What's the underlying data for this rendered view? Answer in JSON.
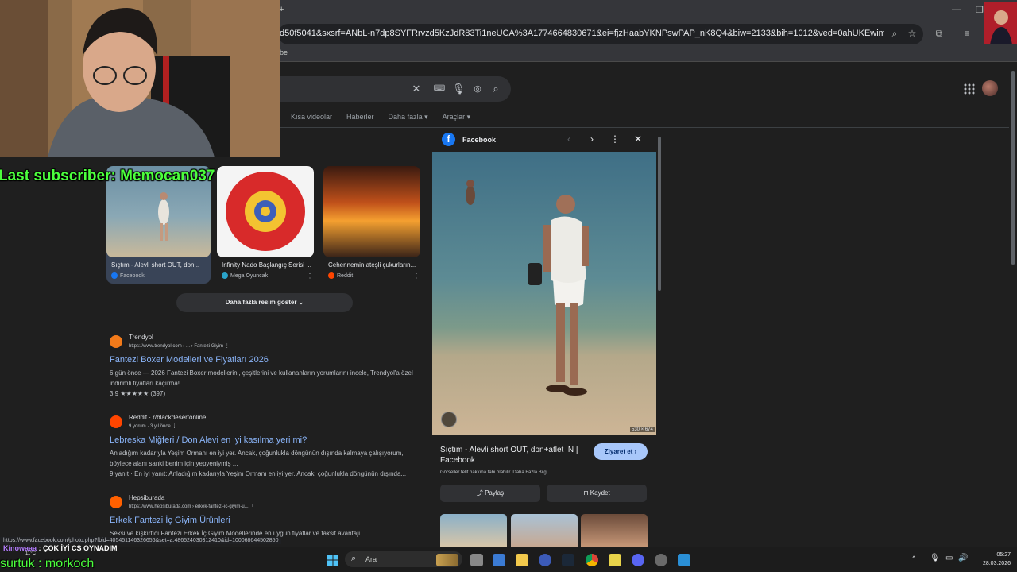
{
  "browser": {
    "url": "d50f5041&sxsrf=ANbL-n7dp8SYFRrvzd5KzJdR83Ti1neUCA%3A1774664830671&ei=fjzHaabYKNPswPAP_nK8Q4&biw=2133&bih=1012&ved=0ahUKEwimj8_WxcGTAxVTNhAIHf-8Mu4...",
    "bookmark": "be",
    "tab_plus": "+"
  },
  "search": {
    "tabs": [
      "Kısa videolar",
      "Haberler",
      "Daha fazla ▾",
      "Araçlar ▾"
    ]
  },
  "thumbs": [
    {
      "title": "Sıçtım - Alevli short OUT, don...",
      "source": "Facebook",
      "source_color": "#1877f2"
    },
    {
      "title": "Infinity Nado Başlangıç Serisi ...",
      "source": "Mega Oyuncak",
      "source_color": "#2aa3c9"
    },
    {
      "title": "Cehennemin ateşli çukurların...",
      "source": "Reddit",
      "source_color": "#ff4500"
    }
  ],
  "more_images_label": "Daha fazla resim göster ⌄",
  "results": [
    {
      "site": "Trendyol",
      "url": "https://www.trendyol.com › ... › Fantezi Giyim   ⋮",
      "title": "Fantezi Boxer Modelleri ve Fiyatları 2026",
      "snippet": "6 gün önce — 2026 Fantezi Boxer modellerini, çeşitlerini ve kullananların yorumlarını incele, Trendyol'a özel indirimli fiyatları kaçırma!",
      "meta": "3,9 ★★★★★ (397)",
      "fav_color": "#f27a1a"
    },
    {
      "site": "Reddit · r/blackdesertonline",
      "url": "9 yorum · 3 yıl önce   ⋮",
      "title": "Lebreska Miğferi / Don Alevi en iyi kasılma yeri mi?",
      "snippet": "Anladığım kadarıyla Yeşim Ormanı en iyi yer. Ancak, çoğunlukla döngünün dışında kalmaya çalışıyorum, böylece alanı sanki benim için yepyeniymiş ...",
      "meta": "9 yanıt · En iyi yanıt: Anladığım kadarıyla Yeşim Ormanı en iyi yer. Ancak, çoğunlukla döngünün dışında...",
      "fav_color": "#ff4500"
    },
    {
      "site": "Hepsiburada",
      "url": "https://www.hepsiburada.com › erkek-fantezi-ic-giyim-u...   ⋮",
      "title": "Erkek Fantezi İç Giyim Ürünleri",
      "snippet": "Seksi ve kışkırtıcı Fantezi Erkek İç Giyim Modellerinde en uygun fiyatlar ve taksit avantajı",
      "meta": "",
      "fav_color": "#ff6000"
    }
  ],
  "panel": {
    "source": "Facebook",
    "dims": "530 × 674",
    "title": "Sıçtım - Alevli short OUT, don+atlet IN | Facebook",
    "visit": "Ziyaret et ›",
    "copyright": "Görseller telif hakkına tabi olabilir.  Daha Fazla Bilgi",
    "share": "⤴ Paylaş",
    "save": "⊓ Kaydet"
  },
  "status_url": "https://www.facebook.com/photo.php?fbid=405451146326656&set=a.486524030312410&id=100068644502850",
  "overlay": {
    "last_subscriber": "Last subscriber: Memocan037",
    "follower": "surtuk : morkoch",
    "chat_user": "Kinowaaa",
    "chat_msg": " : ÇOK İYİ CS OYNADIM",
    "weather": "11°C"
  },
  "taskbar": {
    "search_placeholder": "Ara",
    "time": "05:27",
    "date": "28.03.2026"
  },
  "colors": {
    "link": "#8ab4f8",
    "accent": "#a8c7fa",
    "overlay_green": "#4cff3d"
  }
}
